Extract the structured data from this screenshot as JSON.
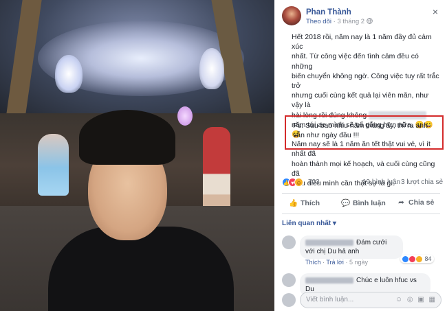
{
  "post": {
    "author": "Phan Thành",
    "follow_label": "Theo dõi",
    "separator": " · ",
    "date": "3 tháng 2",
    "privacy_icon": "globe-icon",
    "close_icon": "×",
    "text_lines": [
      "Hết 2018 rồi, năm nay là 1 năm đầy đủ cảm xúc",
      "nhất. Từ công việc đến tình cảm đều có những",
      "biến chuyển không ngờ. Công việc tuy rất trắc trở",
      "nhưng cuối cùng kết quả lại viên mãn, như vậy là",
      "hài lòng rồi đúng không",
      "năm tới ae mình sẽ cố gắng hơn nữa. 😀😀😀",
      "Năm nay sẽ là 1 năm ăn tết thật vui vẻ, vì ít nhất đã",
      "hoàn thành mọi kế hoạch, và cuối cùng cũng đã",
      "hiểu điều mình cần thật sự là gì."
    ],
    "ps_text": "Ps: Sau bao nhiu năm tháng ấy, thì ra anh vẫn như ngày đầu !!!"
  },
  "stats": {
    "reaction_count": "703",
    "comments": "19 bình luận",
    "shares": "3 lượt chia sẻ"
  },
  "actions": {
    "like": "Thích",
    "comment": "Bình luận",
    "share": "Chia sẻ"
  },
  "comments_sort": "Liên quan nhất ▾",
  "comments": [
    {
      "text": "Đám cưới với chị Du hả anh",
      "like_label": "Thích",
      "reply_label": "Trả lời",
      "time": "5 ngày",
      "reaction_count": "84"
    },
    {
      "text": "Chúc e luôn hfuc vs Du",
      "like_label": "",
      "reply_label": "",
      "time": "",
      "reaction_count": ""
    }
  ],
  "write_comment": {
    "placeholder": "Viết bình luận...",
    "icons": "☺ ◎ ▣ ▦"
  }
}
